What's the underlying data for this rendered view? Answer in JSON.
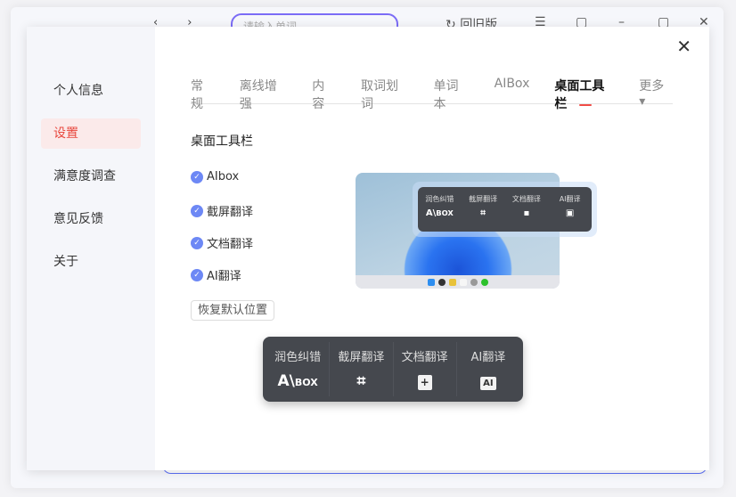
{
  "background_app": {
    "search_placeholder": "请输入单词",
    "old_version": "回旧版"
  },
  "dialog": {
    "close": "✕"
  },
  "sidebar": {
    "items": [
      {
        "label": "个人信息"
      },
      {
        "label": "设置"
      },
      {
        "label": "满意度调查"
      },
      {
        "label": "意见反馈"
      },
      {
        "label": "关于"
      }
    ],
    "active": "设置"
  },
  "tabs": [
    {
      "label": "常规"
    },
    {
      "label": "离线增强"
    },
    {
      "label": "内容"
    },
    {
      "label": "取词划词"
    },
    {
      "label": "单词本"
    },
    {
      "label": "AIBox"
    },
    {
      "label": "桌面工具栏"
    },
    {
      "label": "更多 ▾"
    }
  ],
  "section_title": "桌面工具栏",
  "checkboxes": [
    {
      "label": "AIbox",
      "checked": true
    },
    {
      "label": "截屏翻译",
      "checked": true
    },
    {
      "label": "文档翻译",
      "checked": true
    },
    {
      "label": "AI翻译",
      "checked": true
    }
  ],
  "reset_button": "恢复默认位置",
  "toolbar": [
    {
      "label": "润色纠错",
      "icon": "A\\BOX"
    },
    {
      "label": "截屏翻译",
      "icon": "⌗"
    },
    {
      "label": "文档翻译",
      "icon": "+"
    },
    {
      "label": "AI翻译",
      "icon": "AI"
    }
  ]
}
